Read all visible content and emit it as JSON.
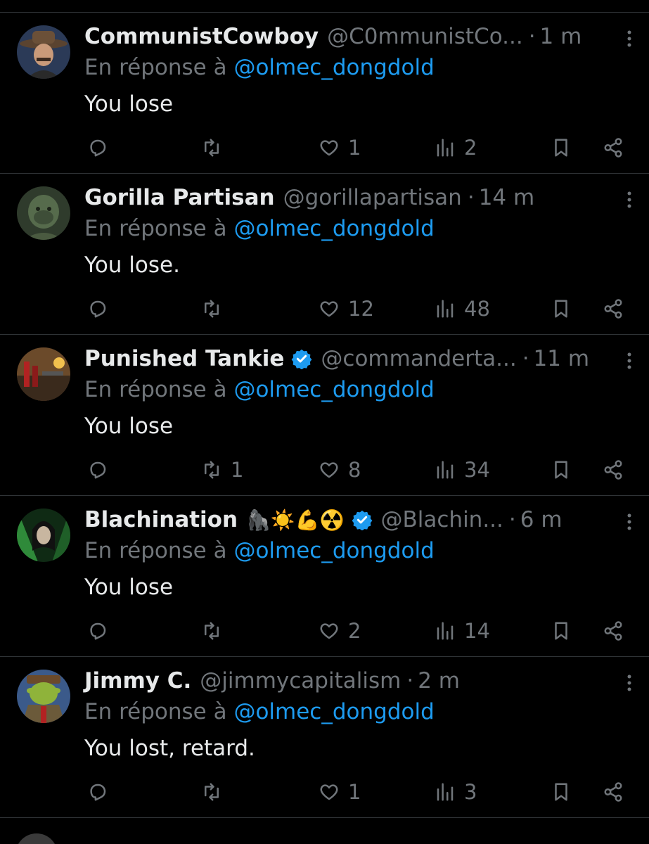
{
  "reply_prefix": "En réponse à",
  "colors": {
    "background": "#000000",
    "text": "#e7e9ea",
    "muted": "#71767b",
    "mention": "#1d9bf0",
    "divider": "#2f3336",
    "verified": "#1d9bf0"
  },
  "icons": {
    "reply": "reply-icon",
    "retweet": "retweet-icon",
    "like": "heart-icon",
    "views": "views-icon",
    "bookmark": "bookmark-icon",
    "share": "share-icon",
    "more": "more-vertical-icon",
    "verified": "verified-badge-icon"
  },
  "tweets": [
    {
      "name": "CommunistCowboy",
      "handle": "@C0mmunistCo...",
      "time": "1 m",
      "verified": false,
      "emojis": "",
      "reply_to": "@olmec_dongdold",
      "text": "You lose",
      "replies": "",
      "retweets": "",
      "likes": "1",
      "views": "2"
    },
    {
      "name": "Gorilla Partisan",
      "handle": "@gorillapartisan",
      "time": "14 m",
      "verified": false,
      "emojis": "",
      "reply_to": "@olmec_dongdold",
      "text": "You lose.",
      "replies": "",
      "retweets": "",
      "likes": "12",
      "views": "48"
    },
    {
      "name": "Punished Tankie",
      "handle": "@commanderta...",
      "time": "11 m",
      "verified": true,
      "emojis": "",
      "reply_to": "@olmec_dongdold",
      "text": "You lose",
      "replies": "",
      "retweets": "1",
      "likes": "8",
      "views": "34"
    },
    {
      "name": "Blachination",
      "handle": "@Blachin...",
      "time": "6 m",
      "verified": true,
      "emojis": "🦍☀️💪☢️",
      "reply_to": "@olmec_dongdold",
      "text": "You lose",
      "replies": "",
      "retweets": "",
      "likes": "2",
      "views": "14"
    },
    {
      "name": "Jimmy C.",
      "handle": "@jimmycapitalism",
      "time": "2 m",
      "verified": false,
      "emojis": "",
      "reply_to": "@olmec_dongdold",
      "text": "You lost, retard.",
      "replies": "",
      "retweets": "",
      "likes": "1",
      "views": "3"
    }
  ]
}
